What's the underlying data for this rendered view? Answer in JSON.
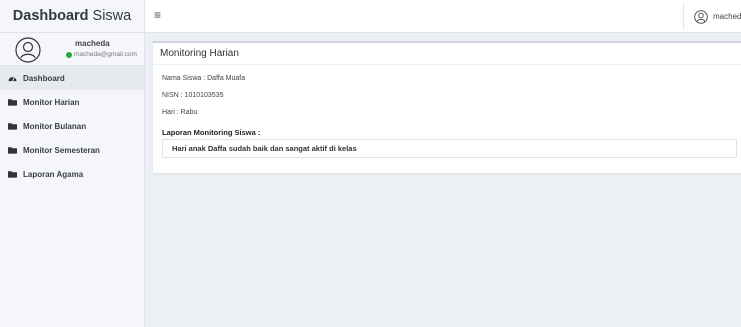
{
  "brand": {
    "bold": "Dashboard",
    "light": "Siswa"
  },
  "user": {
    "name": "macheda",
    "email": "macheda@gmail.com",
    "status_color": "#28a745"
  },
  "nav": [
    {
      "label": "Dashboard",
      "icon": "tachometer-icon"
    },
    {
      "label": "Monitor Harian",
      "icon": "folder-icon"
    },
    {
      "label": "Monitor Bulanan",
      "icon": "folder-icon"
    },
    {
      "label": "Monitor Semesteran",
      "icon": "folder-icon"
    },
    {
      "label": "Laporan Agama",
      "icon": "folder-icon"
    }
  ],
  "topbar": {
    "menu_icon": "hamburger-icon",
    "user_label": "macheda",
    "user_icon": "user-circle-icon"
  },
  "card": {
    "title": "Monitoring Harian",
    "student_name": "Nama Siswa : Daffa Muafa",
    "nisn": "NISN : 1010103535",
    "day": "Hari : Rabu",
    "section_label": "Laporan Monitoring Siswa :",
    "report_text": "Hari anak Daffa sudah baik dan sangat aktif di kelas"
  }
}
